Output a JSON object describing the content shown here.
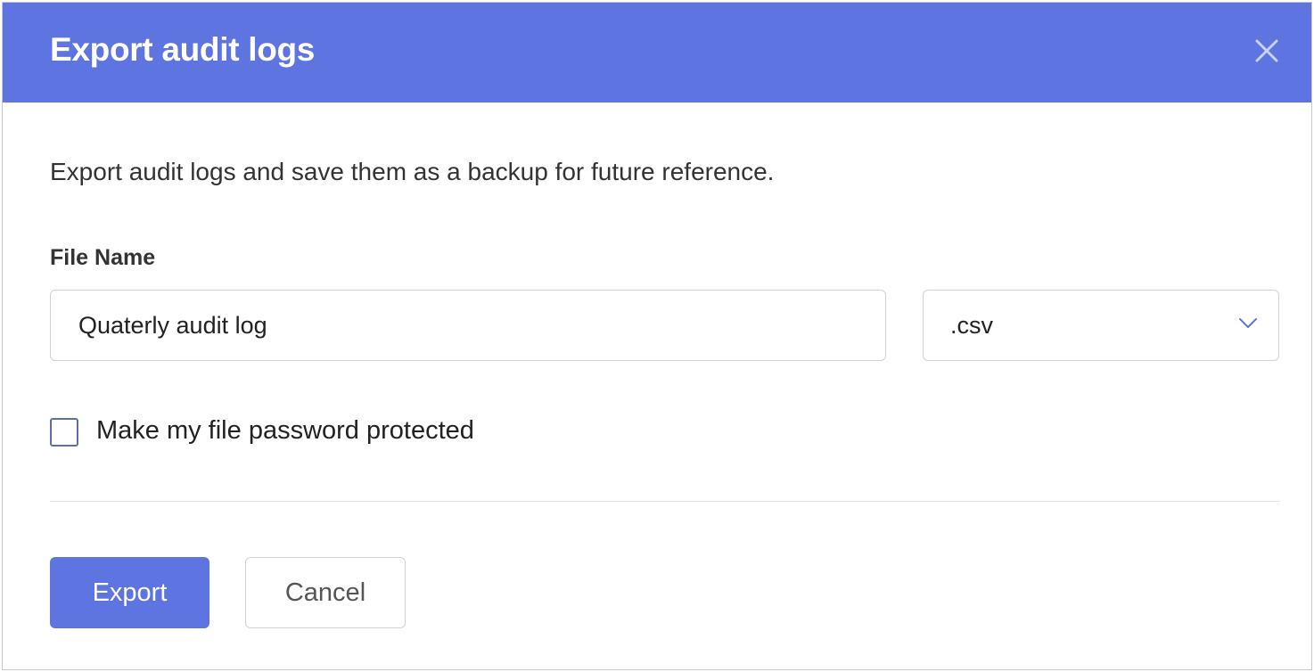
{
  "dialog": {
    "title": "Export audit logs",
    "close_icon": "close-icon",
    "description": "Export audit logs and save them as a backup for future reference.",
    "file_name_label": "File Name",
    "file_name_value": "Quaterly audit log",
    "format_selected": ".csv",
    "format_dropdown_icon": "chevron-down-icon",
    "password_checkbox_label": "Make my file password protected",
    "password_checkbox_checked": false,
    "export_label": "Export",
    "cancel_label": "Cancel"
  },
  "colors": {
    "header_bg": "#5d74e1",
    "primary_button": "#5d74e1",
    "text": "#333333",
    "border": "#d2d2d6"
  }
}
